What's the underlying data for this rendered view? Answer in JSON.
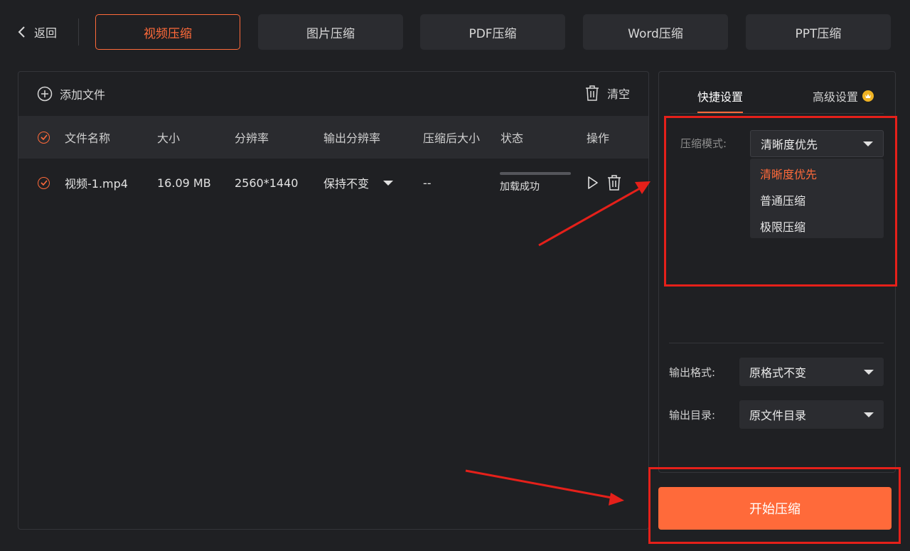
{
  "header": {
    "back_label": "返回",
    "tabs": [
      {
        "label": "视频压缩",
        "active": true
      },
      {
        "label": "图片压缩",
        "active": false
      },
      {
        "label": "PDF压缩",
        "active": false
      },
      {
        "label": "Word压缩",
        "active": false
      },
      {
        "label": "PPT压缩",
        "active": false
      }
    ]
  },
  "file_panel": {
    "add_file_label": "添加文件",
    "clear_label": "清空",
    "columns": [
      "文件名称",
      "大小",
      "分辨率",
      "输出分辨率",
      "压缩后大小",
      "状态",
      "操作"
    ],
    "rows": [
      {
        "name": "视频-1.mp4",
        "size": "16.09 MB",
        "resolution": "2560*1440",
        "output_resolution": "保持不变",
        "compressed_size": "--",
        "status": "加载成功",
        "progress": 1.0
      }
    ]
  },
  "settings": {
    "tab_quick": "快捷设置",
    "tab_advanced": "高级设置",
    "mode_label": "压缩模式:",
    "mode_value": "清晰度优先",
    "mode_options": [
      "清晰度优先",
      "普通压缩",
      "极限压缩"
    ],
    "format_label": "输出格式:",
    "format_value": "原格式不变",
    "dir_label": "输出目录:",
    "dir_value": "原文件目录"
  },
  "start_button_label": "开始压缩",
  "colors": {
    "accent": "#ff6a3a",
    "annotation": "#e5201a",
    "background": "#1f2023",
    "badge": "#f0b323"
  },
  "icons": [
    "chevron-left-icon",
    "plus-circle-icon",
    "trash-icon",
    "check-circle-icon",
    "caret-down-icon",
    "play-icon",
    "crown-badge-icon"
  ]
}
